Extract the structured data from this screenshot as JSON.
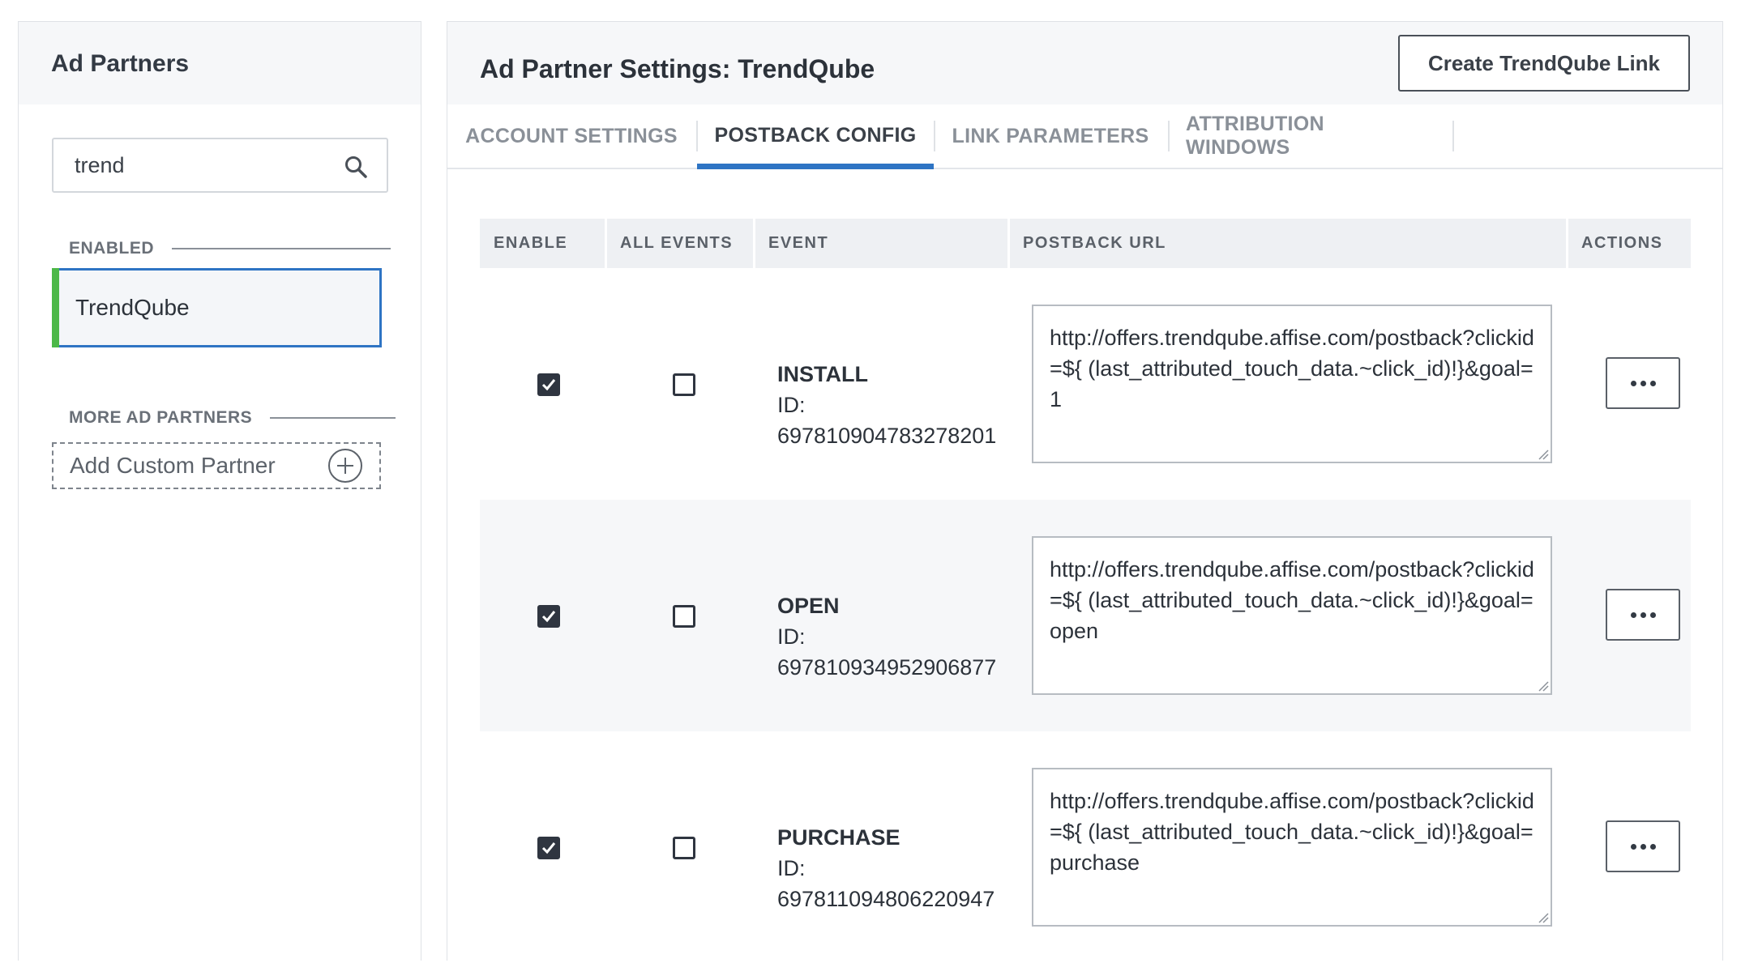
{
  "left_panel": {
    "title": "Ad Partners",
    "search": {
      "value": "trend",
      "placeholder": ""
    },
    "enabled_label": "ENABLED",
    "enabled_partners": [
      {
        "label": "TrendQube"
      }
    ],
    "more_label": "MORE AD PARTNERS",
    "add_custom_label": "Add Custom Partner"
  },
  "header": {
    "title": "Ad Partner Settings: TrendQube",
    "create_link_label": "Create TrendQube Link"
  },
  "tabs": [
    {
      "label": "ACCOUNT SETTINGS",
      "active": false
    },
    {
      "label": "POSTBACK CONFIG",
      "active": true
    },
    {
      "label": "LINK PARAMETERS",
      "active": false
    },
    {
      "label": "ATTRIBUTION WINDOWS",
      "active": false
    }
  ],
  "table": {
    "columns": [
      "ENABLE",
      "ALL EVENTS",
      "EVENT",
      "POSTBACK URL",
      "ACTIONS"
    ],
    "rows": [
      {
        "enabled": true,
        "all_events": false,
        "event": "INSTALL",
        "id_label": "ID:",
        "id": "697810904783278201",
        "postback_url": "http://offers.trendqube.affise.com/postback?clickid=${ (last_attributed_touch_data.~click_id)!}&goal=1"
      },
      {
        "enabled": true,
        "all_events": false,
        "event": "OPEN",
        "id_label": "ID:",
        "id": "697810934952906877",
        "postback_url": "http://offers.trendqube.affise.com/postback?clickid=${ (last_attributed_touch_data.~click_id)!}&goal=open"
      },
      {
        "enabled": true,
        "all_events": false,
        "event": "PURCHASE",
        "id_label": "ID:",
        "id": "697811094806220947",
        "postback_url": "http://offers.trendqube.affise.com/postback?clickid=${ (last_attributed_touch_data.~click_id)!}&goal=purchase"
      }
    ]
  },
  "colors": {
    "accent_blue": "#2e74c4",
    "enabled_green": "#4cb848",
    "header_bg": "#f6f7f9"
  },
  "icons": {
    "search": "search-icon",
    "add": "plus-circle-icon",
    "more": "more-horizontal-icon",
    "checkmark": "checkmark-icon"
  }
}
